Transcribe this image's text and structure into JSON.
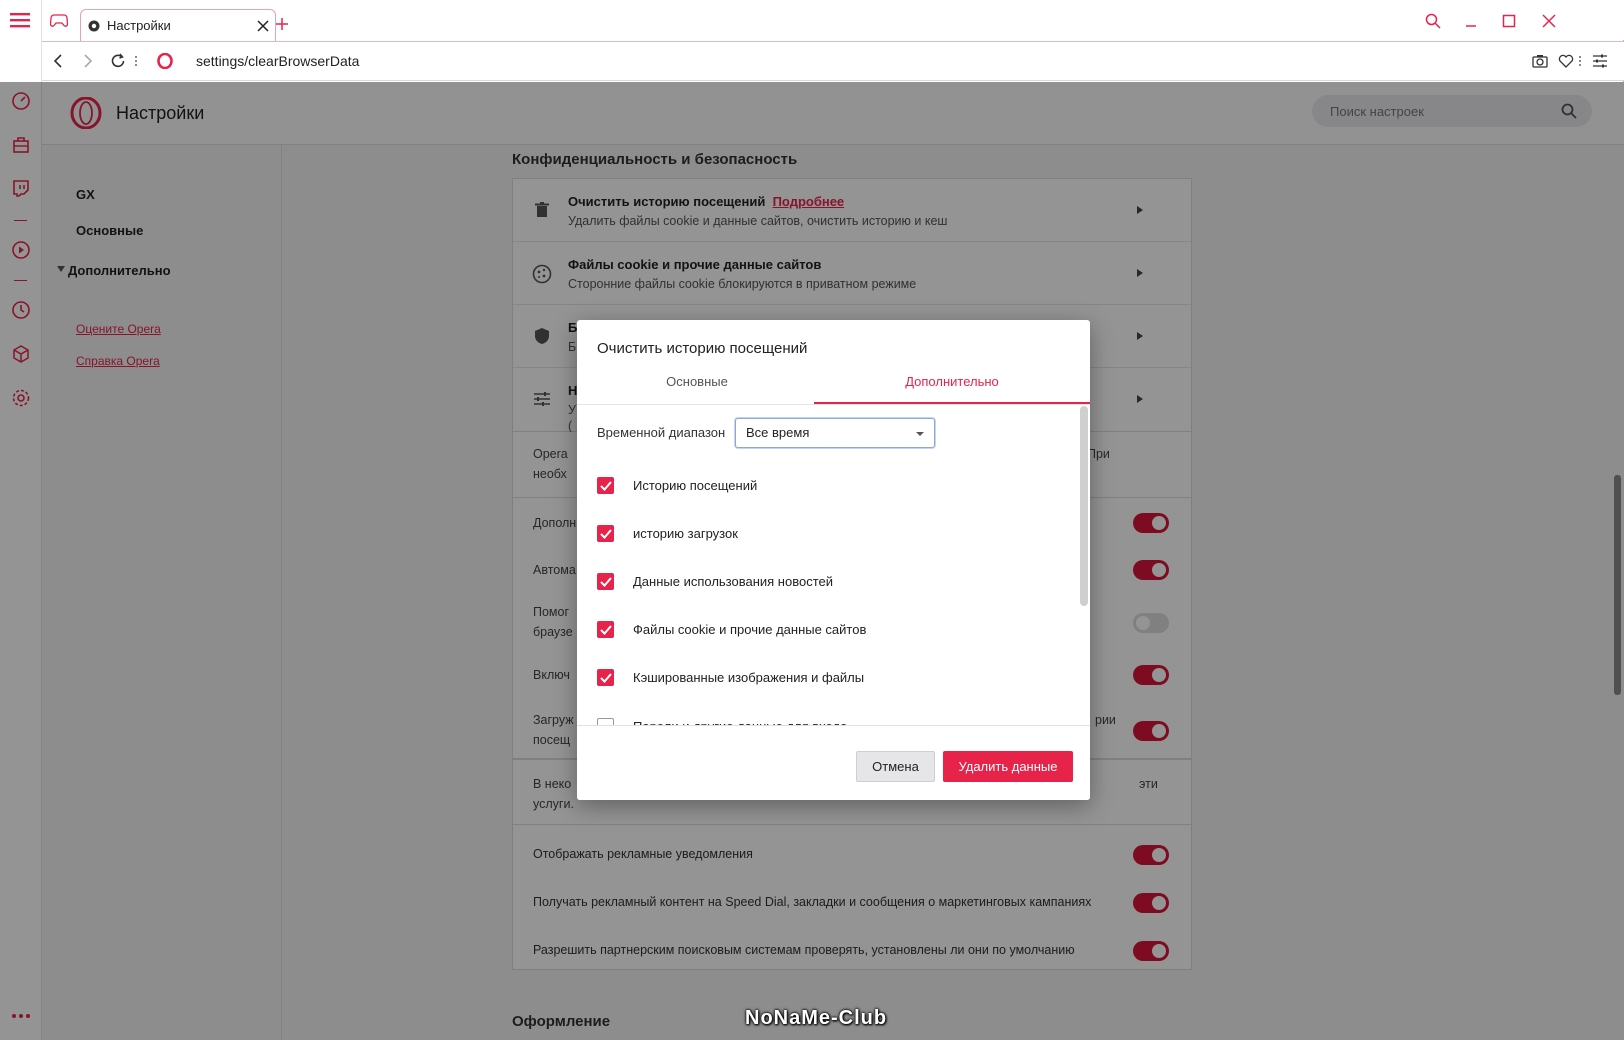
{
  "window": {
    "tab_title": "Настройки",
    "url": "settings/clearBrowserData"
  },
  "colors": {
    "accent": "#e8234a",
    "toggle_on": "#d8163d"
  },
  "sidebar": {
    "icons": [
      "menu-icon",
      "speed-dial-icon",
      "bag-icon",
      "twitch-icon",
      "player-icon",
      "history-icon",
      "cube-icon",
      "gear-icon",
      "more-icon"
    ]
  },
  "page": {
    "title": "Настройки",
    "search_placeholder": "Поиск настроек"
  },
  "nav": {
    "gx": "GX",
    "basic": "Основные",
    "advanced": "Дополнительно",
    "rate": "Оцените Opera",
    "help": "Справка Opera"
  },
  "privacy": {
    "section_title": "Конфиденциальность и безопасность",
    "clear_title": "Очистить историю посещений",
    "clear_more": "Подробнее",
    "clear_sub": "Удалить файлы cookie и данные сайтов, очистить историю и кеш",
    "cookies_title": "Файлы cookie и прочие данные сайтов",
    "cookies_sub": "Сторонние файлы cookie блокируются в приватном режиме",
    "row3_title": "Б",
    "row3_sub": "Б",
    "row4_title": "Н",
    "row4_sub": "У",
    "row4_sub2": "(",
    "opera_text1": "Opera",
    "opera_text1_end": "При",
    "opera_text2": "необх",
    "opt1": "Дополн",
    "opt2": "Автома",
    "opt3a": "Помог",
    "opt3b": "браузе",
    "opt4": "Включ",
    "opt5a": "Загруж",
    "opt5a_end": "рии",
    "opt5b": "посещ",
    "ads_text1": "В неко",
    "ads_text1_end": "эти",
    "ads_text2": "услуги.",
    "show_ads": "Отображать рекламные уведомления",
    "speed_dial_ads": "Получать рекламный контент на Speed Dial, закладки и сообщения о маркетинговых кампаниях",
    "partner_search": "Разрешить партнерским поисковым системам проверять, установлены ли они по умолчанию"
  },
  "appearance": {
    "section_title": "Оформление"
  },
  "dialog": {
    "title": "Очистить историю посещений",
    "tab_basic": "Основные",
    "tab_advanced": "Дополнительно",
    "time_range_label": "Временной диапазон",
    "time_range_value": "Все время",
    "items": [
      {
        "label": "Историю посещений",
        "checked": true
      },
      {
        "label": "историю загрузок",
        "checked": true
      },
      {
        "label": "Данные использования новостей",
        "checked": true
      },
      {
        "label": "Файлы cookie и прочие данные сайтов",
        "checked": true
      },
      {
        "label": "Кэшированные изображения и файлы",
        "checked": true
      },
      {
        "label": "Пароли и другие данные для входа",
        "checked": false
      }
    ],
    "cancel": "Отмена",
    "delete": "Удалить данные"
  },
  "watermark": "NoNaMe-Club"
}
